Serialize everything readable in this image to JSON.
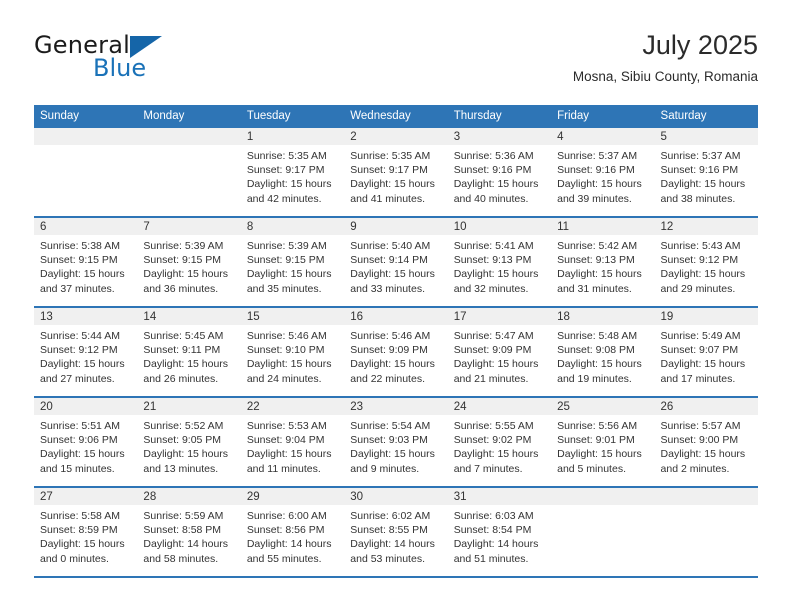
{
  "brand": {
    "name_top": "General",
    "name_bottom": "Blue",
    "triangle_icon": "triangle-icon",
    "accent_color": "#1a72b8"
  },
  "header": {
    "title": "July 2025",
    "subtitle": "Mosna, Sibiu County, Romania"
  },
  "theme": {
    "header_blue": "#2e75b6",
    "date_band_gray": "#f0f0f0",
    "text_color": "#333333"
  },
  "calendar": {
    "weekday_headers": [
      "Sunday",
      "Monday",
      "Tuesday",
      "Wednesday",
      "Thursday",
      "Friday",
      "Saturday"
    ],
    "weeks": [
      [
        {
          "day": "",
          "lines": []
        },
        {
          "day": "",
          "lines": []
        },
        {
          "day": "1",
          "lines": [
            "Sunrise: 5:35 AM",
            "Sunset: 9:17 PM",
            "Daylight: 15 hours",
            "and 42 minutes."
          ]
        },
        {
          "day": "2",
          "lines": [
            "Sunrise: 5:35 AM",
            "Sunset: 9:17 PM",
            "Daylight: 15 hours",
            "and 41 minutes."
          ]
        },
        {
          "day": "3",
          "lines": [
            "Sunrise: 5:36 AM",
            "Sunset: 9:16 PM",
            "Daylight: 15 hours",
            "and 40 minutes."
          ]
        },
        {
          "day": "4",
          "lines": [
            "Sunrise: 5:37 AM",
            "Sunset: 9:16 PM",
            "Daylight: 15 hours",
            "and 39 minutes."
          ]
        },
        {
          "day": "5",
          "lines": [
            "Sunrise: 5:37 AM",
            "Sunset: 9:16 PM",
            "Daylight: 15 hours",
            "and 38 minutes."
          ]
        }
      ],
      [
        {
          "day": "6",
          "lines": [
            "Sunrise: 5:38 AM",
            "Sunset: 9:15 PM",
            "Daylight: 15 hours",
            "and 37 minutes."
          ]
        },
        {
          "day": "7",
          "lines": [
            "Sunrise: 5:39 AM",
            "Sunset: 9:15 PM",
            "Daylight: 15 hours",
            "and 36 minutes."
          ]
        },
        {
          "day": "8",
          "lines": [
            "Sunrise: 5:39 AM",
            "Sunset: 9:15 PM",
            "Daylight: 15 hours",
            "and 35 minutes."
          ]
        },
        {
          "day": "9",
          "lines": [
            "Sunrise: 5:40 AM",
            "Sunset: 9:14 PM",
            "Daylight: 15 hours",
            "and 33 minutes."
          ]
        },
        {
          "day": "10",
          "lines": [
            "Sunrise: 5:41 AM",
            "Sunset: 9:13 PM",
            "Daylight: 15 hours",
            "and 32 minutes."
          ]
        },
        {
          "day": "11",
          "lines": [
            "Sunrise: 5:42 AM",
            "Sunset: 9:13 PM",
            "Daylight: 15 hours",
            "and 31 minutes."
          ]
        },
        {
          "day": "12",
          "lines": [
            "Sunrise: 5:43 AM",
            "Sunset: 9:12 PM",
            "Daylight: 15 hours",
            "and 29 minutes."
          ]
        }
      ],
      [
        {
          "day": "13",
          "lines": [
            "Sunrise: 5:44 AM",
            "Sunset: 9:12 PM",
            "Daylight: 15 hours",
            "and 27 minutes."
          ]
        },
        {
          "day": "14",
          "lines": [
            "Sunrise: 5:45 AM",
            "Sunset: 9:11 PM",
            "Daylight: 15 hours",
            "and 26 minutes."
          ]
        },
        {
          "day": "15",
          "lines": [
            "Sunrise: 5:46 AM",
            "Sunset: 9:10 PM",
            "Daylight: 15 hours",
            "and 24 minutes."
          ]
        },
        {
          "day": "16",
          "lines": [
            "Sunrise: 5:46 AM",
            "Sunset: 9:09 PM",
            "Daylight: 15 hours",
            "and 22 minutes."
          ]
        },
        {
          "day": "17",
          "lines": [
            "Sunrise: 5:47 AM",
            "Sunset: 9:09 PM",
            "Daylight: 15 hours",
            "and 21 minutes."
          ]
        },
        {
          "day": "18",
          "lines": [
            "Sunrise: 5:48 AM",
            "Sunset: 9:08 PM",
            "Daylight: 15 hours",
            "and 19 minutes."
          ]
        },
        {
          "day": "19",
          "lines": [
            "Sunrise: 5:49 AM",
            "Sunset: 9:07 PM",
            "Daylight: 15 hours",
            "and 17 minutes."
          ]
        }
      ],
      [
        {
          "day": "20",
          "lines": [
            "Sunrise: 5:51 AM",
            "Sunset: 9:06 PM",
            "Daylight: 15 hours",
            "and 15 minutes."
          ]
        },
        {
          "day": "21",
          "lines": [
            "Sunrise: 5:52 AM",
            "Sunset: 9:05 PM",
            "Daylight: 15 hours",
            "and 13 minutes."
          ]
        },
        {
          "day": "22",
          "lines": [
            "Sunrise: 5:53 AM",
            "Sunset: 9:04 PM",
            "Daylight: 15 hours",
            "and 11 minutes."
          ]
        },
        {
          "day": "23",
          "lines": [
            "Sunrise: 5:54 AM",
            "Sunset: 9:03 PM",
            "Daylight: 15 hours",
            "and 9 minutes."
          ]
        },
        {
          "day": "24",
          "lines": [
            "Sunrise: 5:55 AM",
            "Sunset: 9:02 PM",
            "Daylight: 15 hours",
            "and 7 minutes."
          ]
        },
        {
          "day": "25",
          "lines": [
            "Sunrise: 5:56 AM",
            "Sunset: 9:01 PM",
            "Daylight: 15 hours",
            "and 5 minutes."
          ]
        },
        {
          "day": "26",
          "lines": [
            "Sunrise: 5:57 AM",
            "Sunset: 9:00 PM",
            "Daylight: 15 hours",
            "and 2 minutes."
          ]
        }
      ],
      [
        {
          "day": "27",
          "lines": [
            "Sunrise: 5:58 AM",
            "Sunset: 8:59 PM",
            "Daylight: 15 hours",
            "and 0 minutes."
          ]
        },
        {
          "day": "28",
          "lines": [
            "Sunrise: 5:59 AM",
            "Sunset: 8:58 PM",
            "Daylight: 14 hours",
            "and 58 minutes."
          ]
        },
        {
          "day": "29",
          "lines": [
            "Sunrise: 6:00 AM",
            "Sunset: 8:56 PM",
            "Daylight: 14 hours",
            "and 55 minutes."
          ]
        },
        {
          "day": "30",
          "lines": [
            "Sunrise: 6:02 AM",
            "Sunset: 8:55 PM",
            "Daylight: 14 hours",
            "and 53 minutes."
          ]
        },
        {
          "day": "31",
          "lines": [
            "Sunrise: 6:03 AM",
            "Sunset: 8:54 PM",
            "Daylight: 14 hours",
            "and 51 minutes."
          ]
        },
        {
          "day": "",
          "lines": []
        },
        {
          "day": "",
          "lines": []
        }
      ]
    ]
  }
}
